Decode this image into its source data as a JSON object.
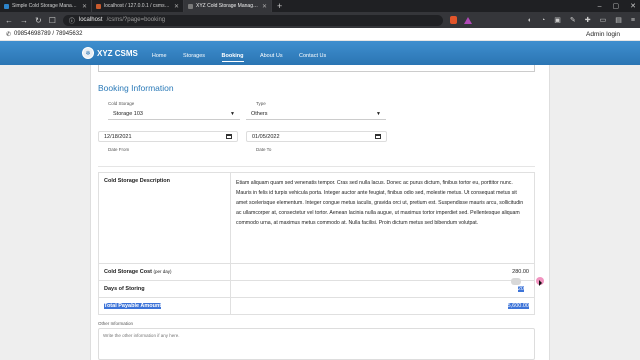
{
  "browser": {
    "tabs": [
      {
        "title": "Simple Cold Storage Management Sy",
        "active": false
      },
      {
        "title": "localhost / 127.0.0.1 / csms_db | phpM",
        "active": false
      },
      {
        "title": "XYZ Cold Storage Management S",
        "active": true
      }
    ],
    "url_host": "localhost",
    "url_path": "/csms/?page=booking"
  },
  "site": {
    "phone": "09854698789 / 78945632",
    "admin_link": "Admin login",
    "brand": "XYZ CSMS",
    "nav": [
      "Home",
      "Storages",
      "Booking",
      "About Us",
      "Contact Us"
    ],
    "active_nav": "Booking"
  },
  "booking": {
    "title": "Booking Information",
    "cold_storage_label": "Cold Storage",
    "cold_storage_value": "Storage 103",
    "type_label": "Type",
    "type_value": "Others",
    "date_from_value": "12/18/2021",
    "date_from_label": "Date From",
    "date_to_value": "01/05/2022",
    "date_to_label": "Date To"
  },
  "summary": {
    "desc_label": "Cold Storage Description",
    "desc_text": "Etiam aliquam quam sed venenatis tempor. Cras sed nulla lacus. Donec ac purus dictum, finibus tortor eu, porttitor nunc. Mauris in felis id turpis vehicula porta. Integer auctor ante feugiat, finibus odio sed, molestie metus. Ut consequat metus sit amet scelerisque elementum. Integer congue metus iaculis, gravida orci ut, pretium est. Suspendisse mauris arcu, sollicitudin ac ullamcorper at, consectetur vel tortor. Aenean lacinia nulla augue, ut maximus tortor imperdiet sed. Pellentesque aliquam commodo urna, at maximus metus commodo at. Nulla facilisi. Proin dictum metus sed bibendum volutpat.",
    "cost_label": "Cold Storage Cost",
    "cost_unit": "(per day)",
    "cost_value": "280.00",
    "days_label": "Days of Storing",
    "days_value": "20",
    "total_label": "Total Payable Amount",
    "total_value": "5,600.00"
  },
  "other": {
    "label": "Other Information",
    "placeholder": "Write the other information if any here."
  },
  "colors": {
    "navbar": "#2b75b3",
    "title": "#2b7ab8",
    "selection": "#3d74d8"
  }
}
